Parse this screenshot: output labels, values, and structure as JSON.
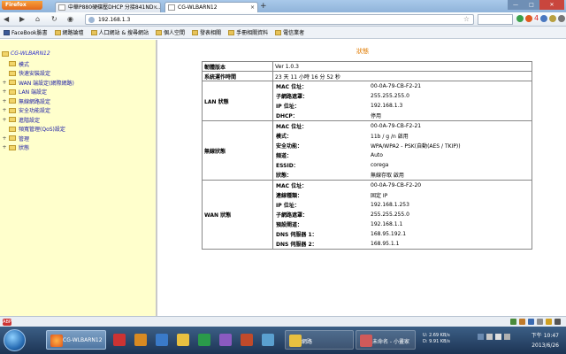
{
  "browser": {
    "app_button": "Firefox",
    "tabs": [
      {
        "label": "中華P880硬碟壓DHCP 分接841ND ..."
      },
      {
        "label": "CG-WLBARN12"
      }
    ],
    "new_tab": "+",
    "url": "192.168.1.3",
    "notification_count": "4",
    "window_controls": {
      "minimize": "—",
      "maximize": "□",
      "close": "✕"
    }
  },
  "bookmarks": [
    {
      "label": "FaceBook臉書",
      "icon": "facebook-icon"
    },
    {
      "label": "網路論壇",
      "icon": "folder-icon"
    },
    {
      "label": "人口網站 & 搜尋網站",
      "icon": "folder-icon"
    },
    {
      "label": "個人空間",
      "icon": "folder-icon"
    },
    {
      "label": "發表相關",
      "icon": "folder-icon"
    },
    {
      "label": "手冊相關資料",
      "icon": "folder-icon"
    },
    {
      "label": "電信業者",
      "icon": "folder-icon"
    }
  ],
  "sidebar": {
    "root": "CG-WLBARN12",
    "items": [
      {
        "label": "模式",
        "expander": ""
      },
      {
        "label": "快速安裝設定",
        "expander": ""
      },
      {
        "label": "WAN 端設定(網際網路)",
        "expander": "+"
      },
      {
        "label": "LAN 端設定",
        "expander": "+"
      },
      {
        "label": "無線網路設定",
        "expander": "+"
      },
      {
        "label": "安全功能設定",
        "expander": "+"
      },
      {
        "label": "進階設定",
        "expander": "+"
      },
      {
        "label": "頻寬管理(QoS)設定",
        "expander": ""
      },
      {
        "label": "管理",
        "expander": "+"
      },
      {
        "label": "狀態",
        "expander": "+"
      }
    ]
  },
  "main": {
    "title": "狀態",
    "firmware_label": "韌體版本",
    "firmware_value": "Ver 1.0.3",
    "uptime_label": "系統運作時間",
    "uptime_value": "23 天 11 小時 16 分 52 秒",
    "lan": {
      "label": "LAN 狀態",
      "rows": [
        {
          "k": "MAC 位址：",
          "v": "00-0A-79-CB-F2-21"
        },
        {
          "k": "子網路遮罩：",
          "v": "255.255.255.0"
        },
        {
          "k": "IP 位址：",
          "v": "192.168.1.3"
        },
        {
          "k": "DHCP：",
          "v": "停用"
        }
      ]
    },
    "wireless": {
      "label": "無線狀態",
      "rows": [
        {
          "k": "MAC 位址：",
          "v": "00-0A-79-CB-F2-21"
        },
        {
          "k": "模式：",
          "v": "11b / g /n 啟用"
        },
        {
          "k": "安全功能：",
          "v": "WPA/WPA2 - PSK(自動(AES / TKIP))"
        },
        {
          "k": "頻道：",
          "v": "Auto"
        },
        {
          "k": "ESSID：",
          "v": "corega"
        },
        {
          "k": "狀態：",
          "v": "無線存取 啟用"
        }
      ]
    },
    "wan": {
      "label": "WAN 狀態",
      "rows": [
        {
          "k": "MAC 位址：",
          "v": "00-0A-79-CB-F2-20"
        },
        {
          "k": "連線種類：",
          "v": "固定 IP"
        },
        {
          "k": "IP 位址：",
          "v": "192.168.1.253"
        },
        {
          "k": "子網路遮罩：",
          "v": "255.255.255.0"
        },
        {
          "k": "預設閘道：",
          "v": "192.168.1.1"
        },
        {
          "k": "DNS 伺服器 1：",
          "v": "168.95.192.1"
        },
        {
          "k": "DNS 伺服器 2：",
          "v": "168.95.1.1"
        }
      ]
    }
  },
  "taskbar": {
    "active_window": "CG-WLBARN12",
    "window2": "網路",
    "window3": "未命名 - 小畫家",
    "net_up_label": "U:",
    "net_up": "2.69 KB/s",
    "net_down_label": "D:",
    "net_down": "9.91 KB/s",
    "time": "下午 10:47",
    "date": "2013/6/26"
  },
  "colors": {
    "sidebar_bg": "#ffffcc",
    "title_orange": "#e07b00",
    "link_blue": "#1a1aa6"
  }
}
